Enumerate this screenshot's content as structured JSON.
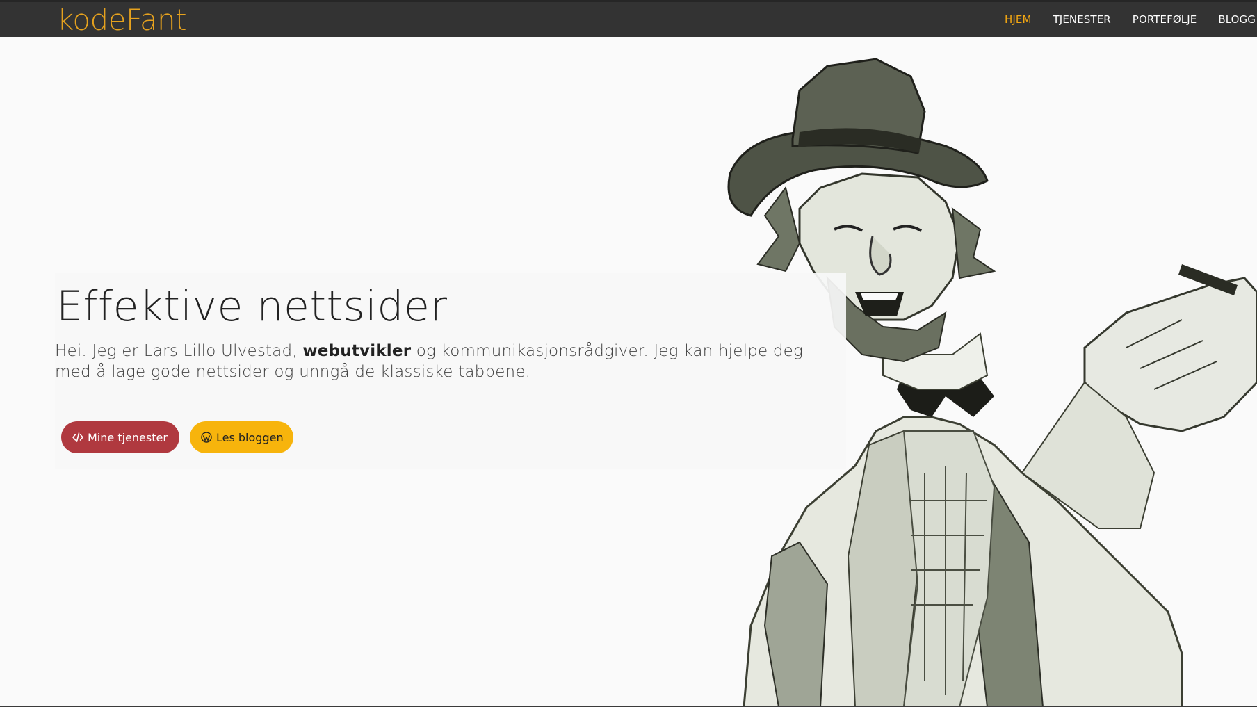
{
  "brand": {
    "name": "kodeFant",
    "color": "#e6a21e"
  },
  "nav": {
    "items": [
      {
        "label": "HJEM",
        "active": true
      },
      {
        "label": "TJENESTER",
        "active": false
      },
      {
        "label": "PORTEFØLJE",
        "active": false
      },
      {
        "label": "BLOGG",
        "active": false
      }
    ],
    "active_color": "#f3a712"
  },
  "hero": {
    "title": "Effektive nettsider",
    "intro_before": "Hei. Jeg er Lars Lillo Ulvestad, ",
    "intro_emphasis": "webutvikler",
    "intro_after": " og kommunikasjonsrådgiver. Jeg kan hjelpe deg med å lage gode nettsider og unngå de klassiske tabbene.",
    "buttons": {
      "services": {
        "label": "Mine tjenester",
        "icon": "code-icon",
        "color": "#b0393f"
      },
      "blog": {
        "label": "Les bloggen",
        "icon": "wordpress-icon",
        "color": "#f7b40c"
      }
    }
  },
  "illustration": {
    "subject": "vagabond-cartoon-illustration"
  }
}
